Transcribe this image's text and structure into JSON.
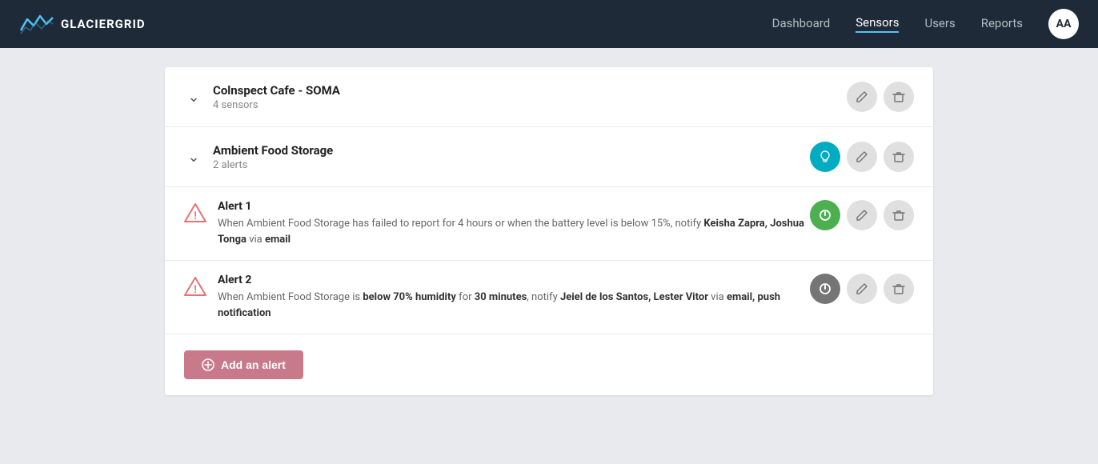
{
  "nav": {
    "logo_text": "GLACIERGRID",
    "links": [
      {
        "label": "Dashboard",
        "active": false
      },
      {
        "label": "Sensors",
        "active": true
      },
      {
        "label": "Users",
        "active": false
      },
      {
        "label": "Reports",
        "active": false
      }
    ],
    "avatar_initials": "AA"
  },
  "location": {
    "name": "Colnspect Cafe - SOMA",
    "sub": "4 sensors"
  },
  "sensor_group": {
    "name": "Ambient Food Storage",
    "sub": "2 alerts"
  },
  "alerts": [
    {
      "id": "Alert 1",
      "description_prefix": "When Ambient Food Storage has failed to report for 4 hours or when the battery level is below 15%, notify ",
      "bold_names": "Keisha Zapra, Joshua Tonga",
      "via_prefix": " via ",
      "via_bold": "email",
      "active": true
    },
    {
      "id": "Alert 2",
      "description_prefix": "When Ambient Food Storage is ",
      "bold_condition": "below 70% humidity",
      "for_text": " for ",
      "bold_duration": "30 minutes",
      "notify_text": ", notify ",
      "bold_names": "Jeiel de los Santos, Lester Vitor",
      "via_prefix": " via ",
      "via_bold": "email, push notification",
      "active": false
    }
  ],
  "add_alert_btn": "Add an alert"
}
